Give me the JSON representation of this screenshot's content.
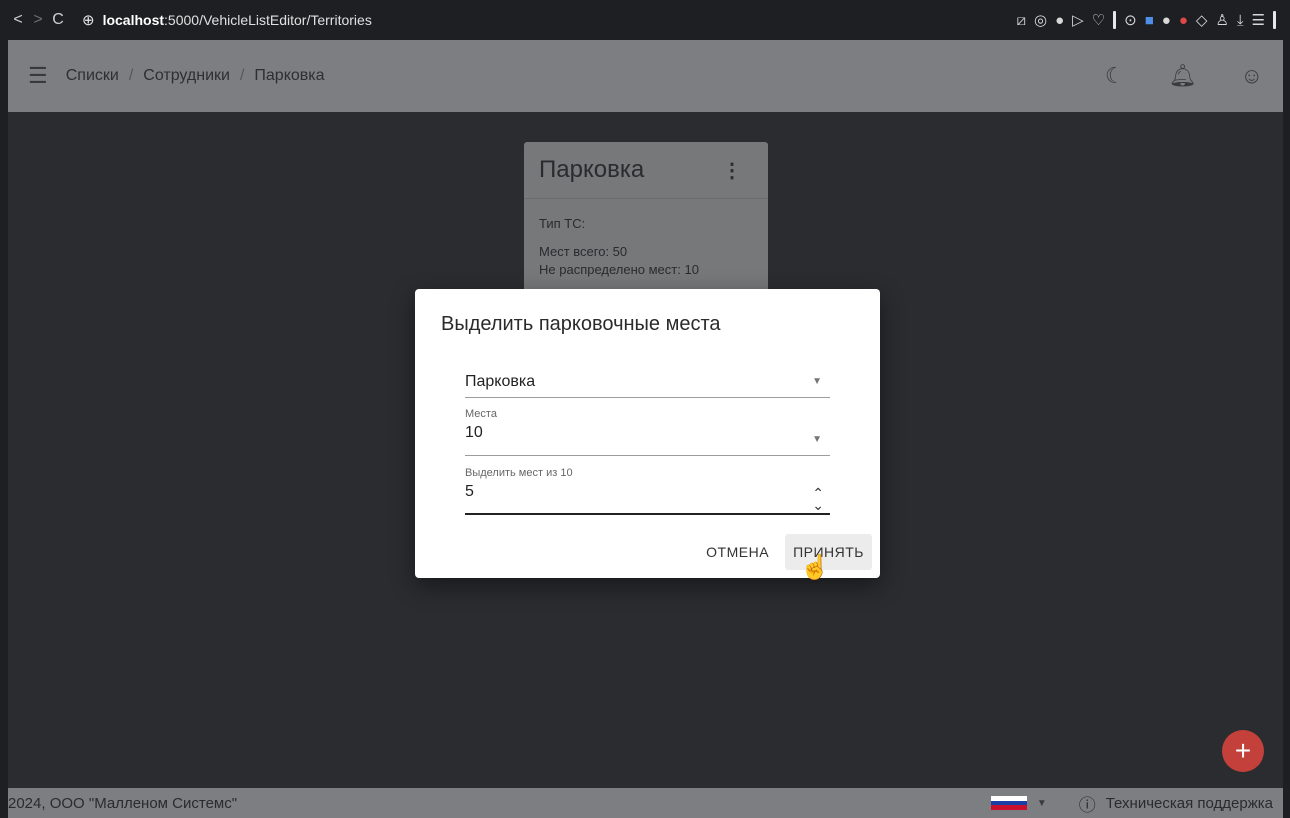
{
  "browser": {
    "back": "<",
    "forward": ">",
    "reload": "C",
    "url_host": "localhost",
    "url_path": ":5000/VehicleListEditor/Territories",
    "ext_icons": [
      "chart-icon",
      "camera-icon",
      "shield-check-icon",
      "play-icon",
      "heart-icon"
    ]
  },
  "appbar": {
    "breadcrumbs": [
      "Списки",
      "Сотрудники",
      "Парковка"
    ],
    "separator": "/"
  },
  "card": {
    "title": "Парковка",
    "vehicle_type": "Тип ТС:",
    "total_spots": "Мест всего: 50",
    "unassigned_spots": "Не распределено мест: 10"
  },
  "dialog": {
    "title": "Выделить парковочные места",
    "parking_select": {
      "value": "Парковка"
    },
    "spots_select": {
      "label": "Места",
      "value": "10"
    },
    "allocate_input": {
      "label": "Выделить мест из 10",
      "value": "5"
    },
    "cancel_label": "ОТМЕНА",
    "accept_label": "ПРИНЯТЬ"
  },
  "fab": {
    "label": "+"
  },
  "footer": {
    "copyright": "2024, ООО \"Малленом Системс\"",
    "support": "Техническая поддержка"
  },
  "colors": {
    "fab": "#c4413b",
    "appbar": "#7d7e81",
    "background": "#2b2c30"
  }
}
